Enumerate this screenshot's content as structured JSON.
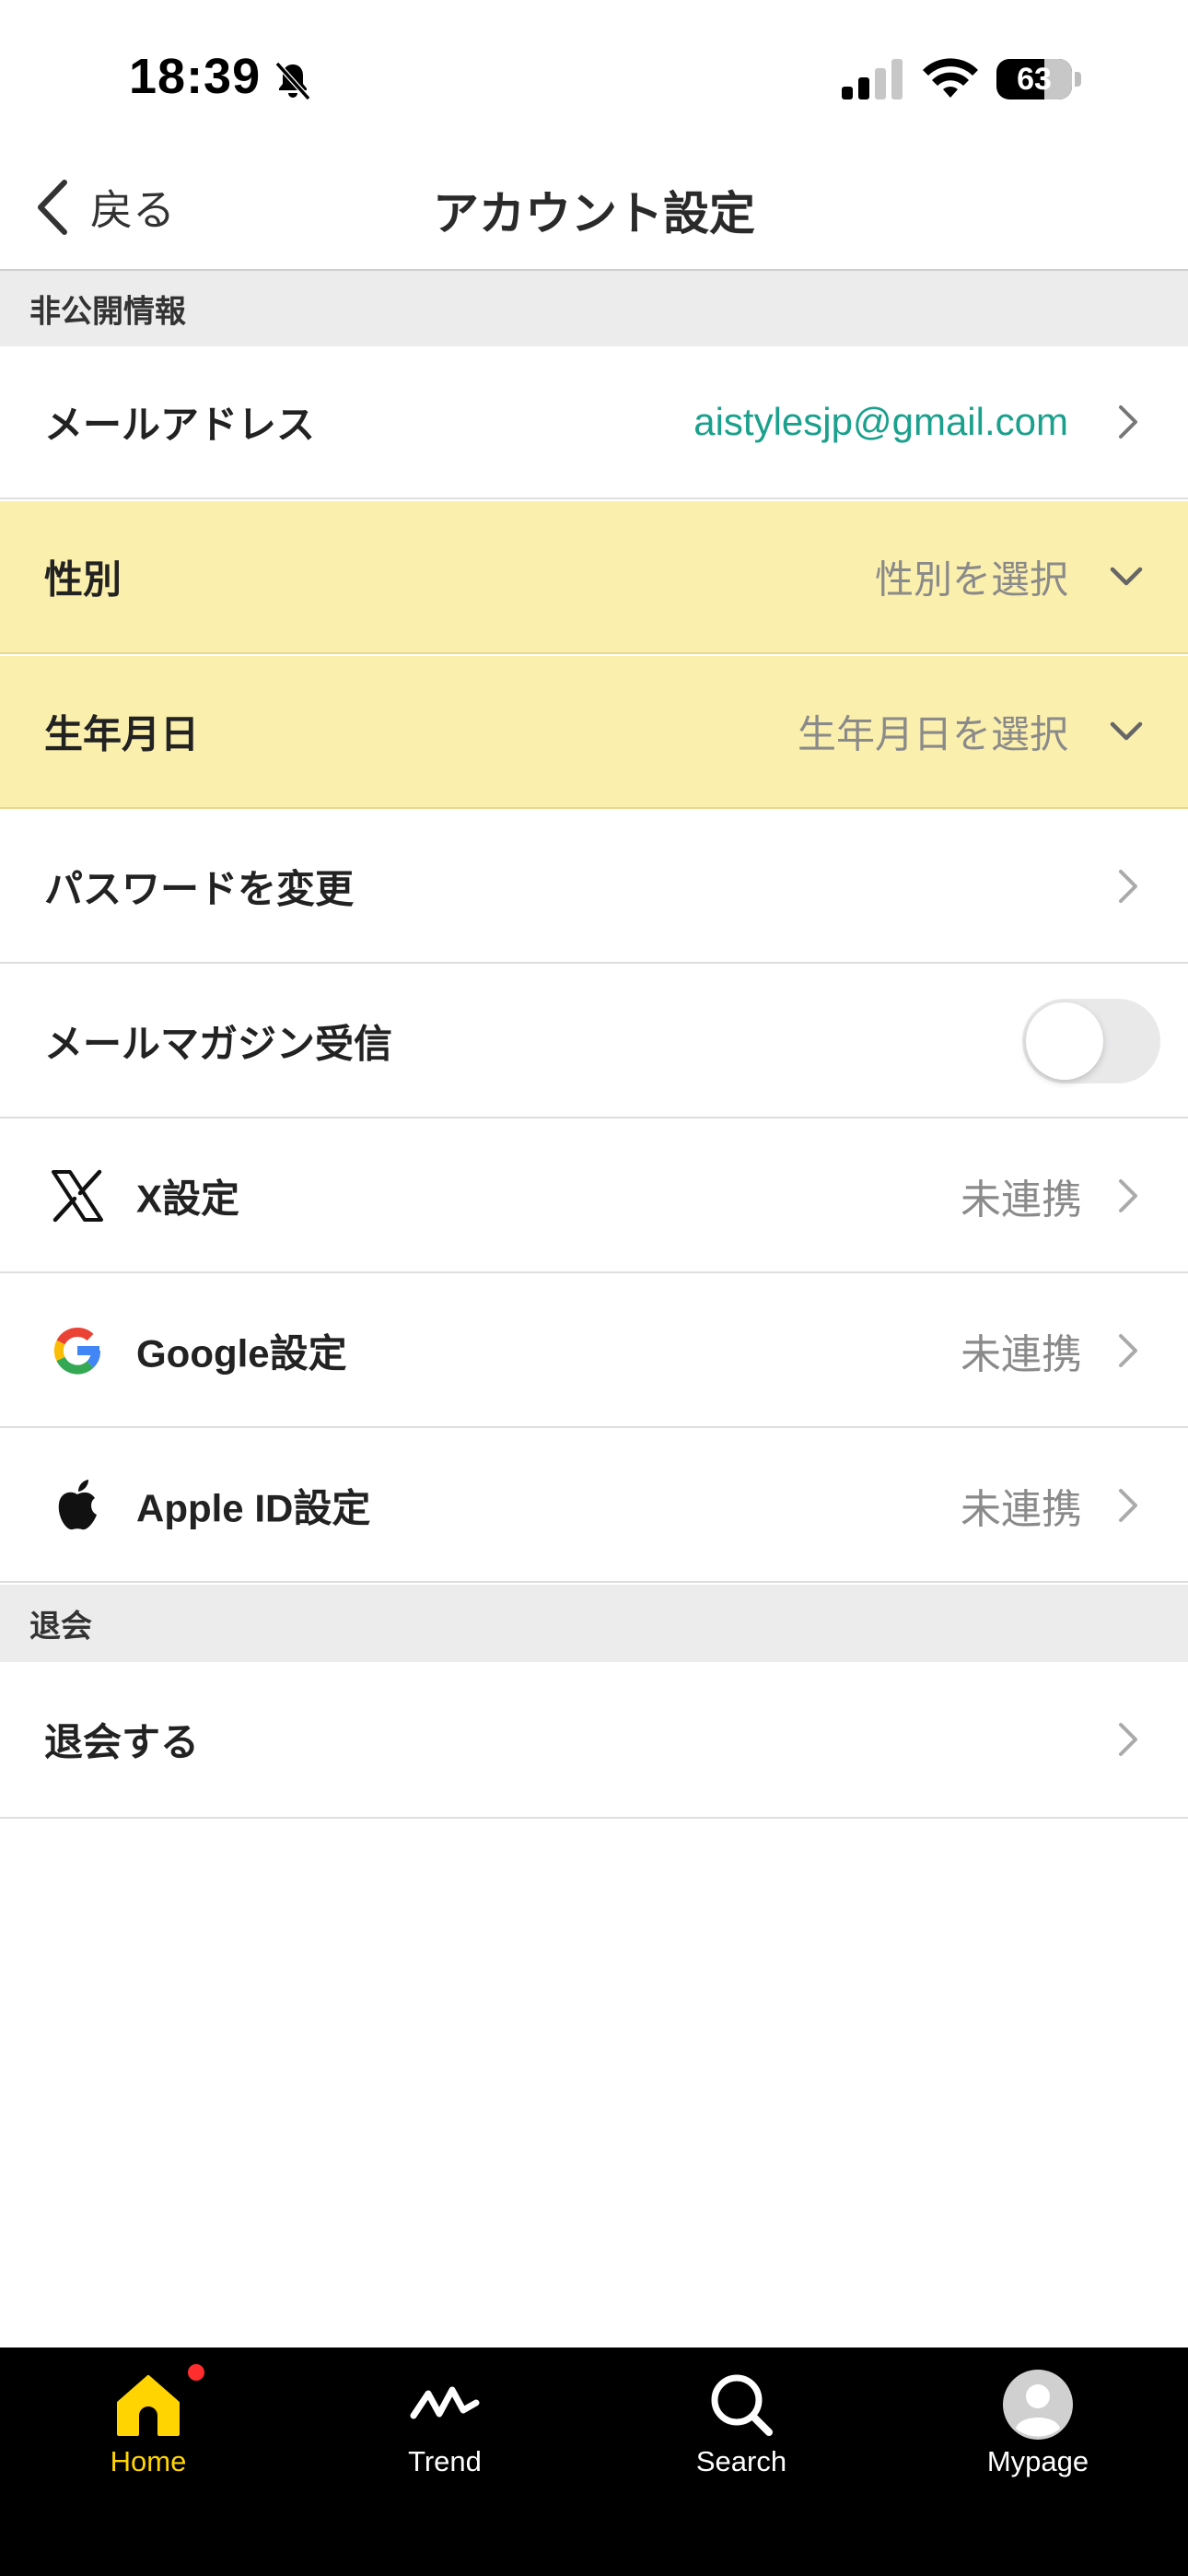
{
  "status_bar": {
    "time": "18:39",
    "battery": "63",
    "battery_level": 0.63
  },
  "nav": {
    "back_label": "戻る",
    "title": "アカウント設定"
  },
  "sections": {
    "private_info": "非公開情報",
    "withdraw": "退会"
  },
  "rows": {
    "email": {
      "label": "メールアドレス",
      "value": "aistylesjp@gmail.com"
    },
    "gender": {
      "label": "性別",
      "value": "性別を選択"
    },
    "birthday": {
      "label": "生年月日",
      "value": "生年月日を選択"
    },
    "password": {
      "label": "パスワードを変更"
    },
    "newsletter": {
      "label": "メールマガジン受信",
      "enabled": false
    },
    "x": {
      "label": "X設定",
      "status": "未連携"
    },
    "google": {
      "label": "Google設定",
      "status": "未連携"
    },
    "apple": {
      "label": "Apple ID設定",
      "status": "未連携"
    },
    "withdraw": {
      "label": "退会する"
    }
  },
  "tabs": [
    {
      "label": "Home",
      "icon": "home-icon",
      "active": true,
      "badge": true
    },
    {
      "label": "Trend",
      "icon": "trend-icon",
      "active": false
    },
    {
      "label": "Search",
      "icon": "search-icon",
      "active": false
    },
    {
      "label": "Mypage",
      "icon": "avatar-icon",
      "active": false
    }
  ],
  "colors": {
    "accent_yellow": "#ffd400",
    "highlight_row": "#fbefae",
    "email_text": "#1aa08c",
    "badge": "#ff2d2d"
  }
}
